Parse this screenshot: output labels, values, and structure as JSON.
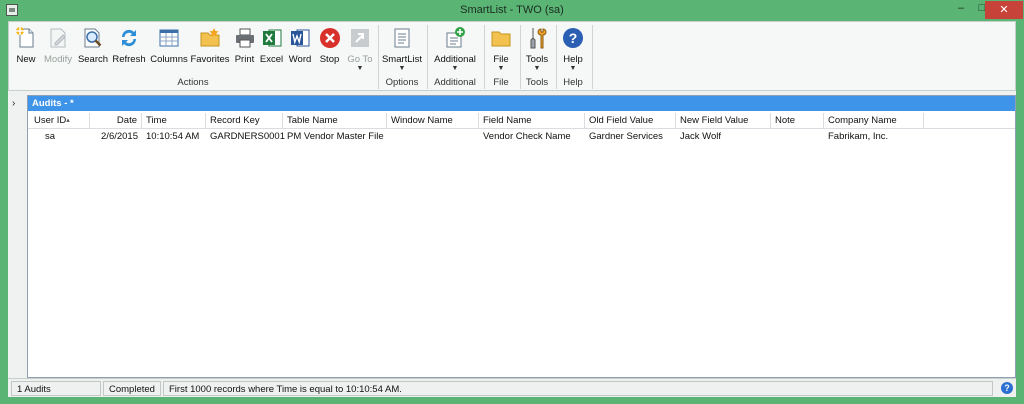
{
  "window": {
    "title": "SmartList  -  TWO (sa)",
    "minimize": "–",
    "maximize": "□",
    "close": "✕"
  },
  "ribbon": {
    "buttons": {
      "new": "New",
      "modify": "Modify",
      "search": "Search",
      "refresh": "Refresh",
      "columns": "Columns",
      "favorites": "Favorites",
      "print": "Print",
      "excel": "Excel",
      "word": "Word",
      "stop": "Stop",
      "goto": "Go To",
      "smartlist": "SmartList",
      "additional": "Additional",
      "file": "File",
      "tools": "Tools",
      "help": "Help"
    },
    "groups": {
      "actions": "Actions",
      "options": "Options",
      "additional": "Additional",
      "file": "File",
      "tools": "Tools",
      "help": "Help"
    },
    "dropdown_arrow": "▼"
  },
  "panel": {
    "title": "Audits - *",
    "expander": "›",
    "sort_marker": "▴",
    "columns": [
      "User ID",
      "Date",
      "Time",
      "Record Key",
      "Table Name",
      "Window Name",
      "Field Name",
      "Old Field Value",
      "New Field Value",
      "Note",
      "Company Name"
    ],
    "rows": [
      [
        "sa",
        "2/6/2015",
        "10:10:54 AM",
        "GARDNERS0001",
        "PM Vendor Master File",
        "",
        "Vendor Check Name",
        "Gardner Services",
        "Jack Wolf",
        "",
        "Fabrikam, Inc."
      ]
    ]
  },
  "status": {
    "count": "1 Audits",
    "state": "Completed",
    "message": "First 1000 records where Time is equal to 10:10:54 AM.",
    "help": "?"
  }
}
